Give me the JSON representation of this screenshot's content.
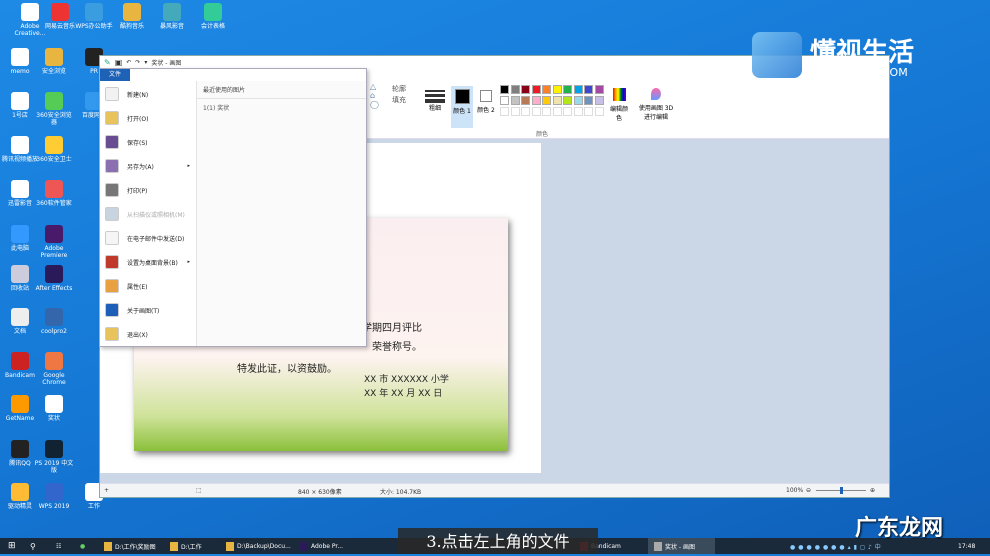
{
  "desktop_icons": [
    {
      "label": "Adobe Creative..."
    },
    {
      "label": "网易云音乐"
    },
    {
      "label": "WPS办公助手"
    },
    {
      "label": "酷狗音乐"
    },
    {
      "label": "暴风影音"
    },
    {
      "label": "会计表格"
    },
    {
      "label": "memo"
    },
    {
      "label": "安全浏览"
    },
    {
      "label": "PR"
    },
    {
      "label": "1号店"
    },
    {
      "label": "360安全浏览器"
    },
    {
      "label": "百度网盘"
    },
    {
      "label": "腾讯视频播放"
    },
    {
      "label": "360安全卫士"
    },
    {
      "label": "迅雷影音"
    },
    {
      "label": "360软件管家"
    },
    {
      "label": "此电脑"
    },
    {
      "label": "Adobe Premiere"
    },
    {
      "label": "回收站"
    },
    {
      "label": "After Effects"
    },
    {
      "label": "文档"
    },
    {
      "label": "coolpro2"
    },
    {
      "label": "Bandicam"
    },
    {
      "label": "Google Chrome"
    },
    {
      "label": "GetName"
    },
    {
      "label": "奖状"
    },
    {
      "label": "腾讯QQ"
    },
    {
      "label": "PS 2019 中文版"
    },
    {
      "label": "驱动精灵"
    },
    {
      "label": "WPS 2019"
    },
    {
      "label": "工作"
    }
  ],
  "paint": {
    "title": "奖状 - 画图",
    "file_tab": "文件",
    "file_menu": [
      {
        "label": "新建(N)",
        "icon": "new-file-icon",
        "color": "#f2f2f2"
      },
      {
        "label": "打开(O)",
        "icon": "open-folder-icon",
        "color": "#e8c25a"
      },
      {
        "label": "保存(S)",
        "icon": "save-icon",
        "color": "#6a4c93"
      },
      {
        "label": "另存为(A)",
        "icon": "save-as-icon",
        "color": "#8c6fb0",
        "submenu": true
      },
      {
        "label": "打印(P)",
        "icon": "printer-icon",
        "color": "#777"
      },
      {
        "label": "从扫描仪或照相机(M)",
        "icon": "scanner-icon",
        "color": "#c8d4e0",
        "disabled": true
      },
      {
        "label": "在电子邮件中发送(D)",
        "icon": "email-icon",
        "color": "#f5f5f5"
      },
      {
        "label": "设置为桌面背景(B)",
        "icon": "desktop-background-icon",
        "color": "#c0392b",
        "submenu": true
      },
      {
        "label": "属性(E)",
        "icon": "checkmark-icon",
        "color": "#e8a040"
      },
      {
        "label": "关于画图(T)",
        "icon": "info-icon",
        "color": "#1e5fb8"
      },
      {
        "label": "退出(X)",
        "icon": "exit-icon",
        "color": "#e8c25a"
      }
    ],
    "recent_header": "最近使用的图片",
    "recent_items": [
      "1(1)  奖状"
    ],
    "ribbon": {
      "outline": "轮廓",
      "fill": "填充",
      "size": "粗细",
      "color1": "颜色 1",
      "color2": "颜色 2",
      "edit_colors": "编辑颜色",
      "paint3d": "使用画图 3D 进行编辑",
      "colors_group": "颜色",
      "palette_row1": [
        "#000000",
        "#7f7f7f",
        "#880015",
        "#ed1c24",
        "#ff7f27",
        "#fff200",
        "#22b14c",
        "#00a2e8",
        "#3f48cc",
        "#a349a4"
      ],
      "palette_row2": [
        "#ffffff",
        "#c3c3c3",
        "#b97a57",
        "#ffaec9",
        "#ffc90e",
        "#efe4b0",
        "#b5e61d",
        "#99d9ea",
        "#7092be",
        "#c8bfe7"
      ]
    },
    "certificate": {
      "line1": "学期四月评比",
      "line2": "荣誉称号。",
      "line3": "特发此证，以资鼓励。",
      "school": "XX 市 XXXXXX 小学",
      "date": "XX 年 XX 月 XX 日"
    },
    "status": {
      "dimensions": "840 × 630像素",
      "size": "大小: 104.7KB",
      "zoom": "100%",
      "zoom_level": 100
    }
  },
  "taskbar": {
    "items": [
      "D:\\工作\\奖励图",
      "D:\\工作",
      "D:\\Backup\\Docu...",
      "Adobe Pr...",
      "Bandicam",
      "奖状 - 画图"
    ],
    "time": "17:48"
  },
  "caption": "3.点击左上角的文件",
  "watermark_top": {
    "name": "懂视生活",
    "url": "51DONGSHI.COM"
  },
  "watermark_bottom": "广东龙网"
}
